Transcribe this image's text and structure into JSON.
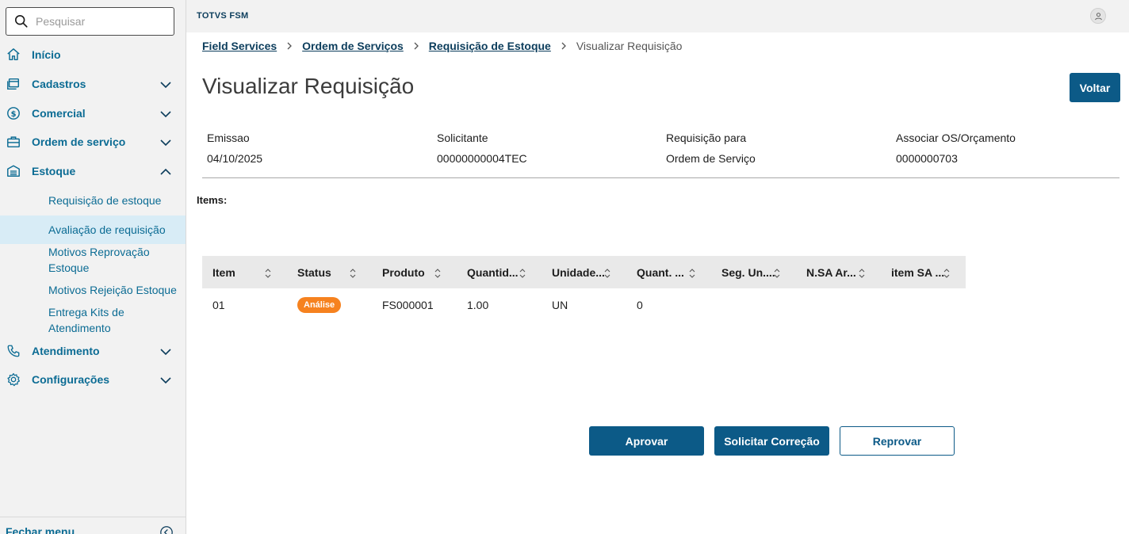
{
  "search": {
    "placeholder": "Pesquisar"
  },
  "sidebar": {
    "items": [
      {
        "label": "Início",
        "icon": "home-icon"
      },
      {
        "label": "Cadastros",
        "icon": "window-icon"
      },
      {
        "label": "Comercial",
        "icon": "dollar-icon"
      },
      {
        "label": "Ordem de serviço",
        "icon": "briefcase-icon"
      },
      {
        "label": "Estoque",
        "icon": "warehouse-icon"
      },
      {
        "label": "Atendimento",
        "icon": "phone-icon"
      },
      {
        "label": "Configurações",
        "icon": "gear-icon"
      }
    ],
    "estoque_sub": [
      {
        "label": "Requisição de estoque"
      },
      {
        "label": "Avaliação de requisição"
      },
      {
        "label": "Motivos Reprovação Estoque"
      },
      {
        "label": "Motivos Rejeição Estoque"
      },
      {
        "label": "Entrega Kits de Atendimento"
      }
    ],
    "close_label": "Fechar menu"
  },
  "header": {
    "brand": "TOTVS FSM"
  },
  "breadcrumb": {
    "links": [
      "Field Services",
      "Ordem de Serviços",
      "Requisição de Estoque"
    ],
    "current": "Visualizar Requisição"
  },
  "page": {
    "title": "Visualizar Requisição",
    "back_label": "Voltar",
    "items_label": "Items:"
  },
  "info": [
    {
      "label": "Emissao",
      "value": "04/10/2025"
    },
    {
      "label": "Solicitante",
      "value": "00000000004TEC"
    },
    {
      "label": "Requisição para",
      "value": "Ordem de Serviço"
    },
    {
      "label": "Associar OS/Orçamento",
      "value": "0000000703"
    }
  ],
  "table": {
    "columns": [
      "Item",
      "Status",
      "Produto",
      "Quantid...",
      "Unidade...",
      "Quant. ...",
      "Seg. Un....",
      "N.SA Ar...",
      "item SA ..."
    ],
    "rows": [
      {
        "item": "01",
        "status": "Análise",
        "produto": "FS000001",
        "quantidade": "1.00",
        "unidade": "UN",
        "quant2": "0",
        "seg_un": "",
        "nsa": "",
        "item_sa": ""
      }
    ]
  },
  "actions": {
    "approve": "Aprovar",
    "request_correction": "Solicitar Correção",
    "reject": "Reprovar"
  },
  "colors": {
    "primary": "#0c5a87",
    "link": "#0c6c94",
    "status_analysis": "#f6821f",
    "active_item_bg": "#d8ecf6"
  }
}
